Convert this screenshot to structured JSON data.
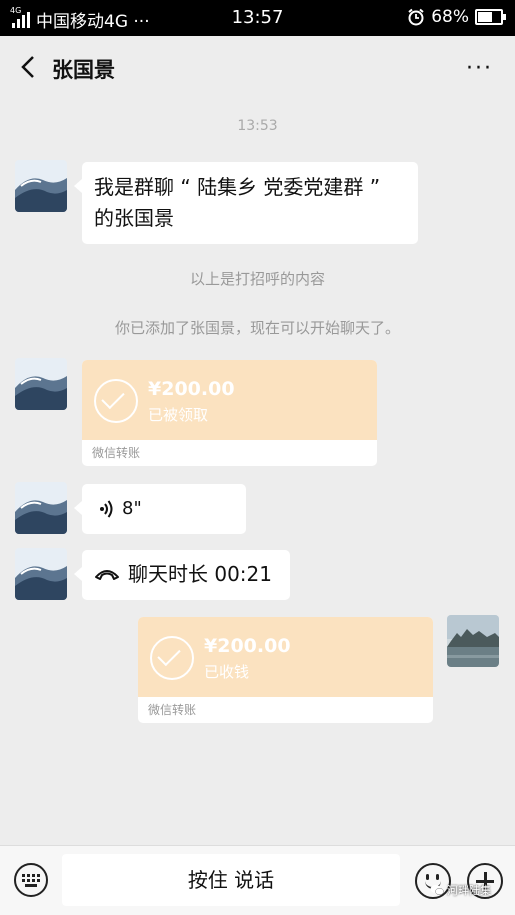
{
  "status_bar": {
    "network_badge": "4G",
    "carrier": "中国移动4G ···",
    "time": "13:57",
    "battery": "68%",
    "battery_level": 0.68
  },
  "nav": {
    "title": "张国景",
    "more": "···"
  },
  "chat": {
    "timestamp": "13:53",
    "greeting_line1": "我是群聊 “ 陆集乡 党委党建群 ”",
    "greeting_line2": "的张国景",
    "system_greet": "以上是打招呼的内容",
    "system_added": "你已添加了张国景，现在可以开始聊天了。",
    "transfer_in": {
      "amount": "¥200.00",
      "status": "已被领取",
      "label": "微信转账"
    },
    "voice": {
      "duration": "8\""
    },
    "call": {
      "text": "聊天时长 00:21"
    },
    "transfer_out": {
      "amount": "¥200.00",
      "status": "已收钱",
      "label": "微信转账"
    }
  },
  "bottom_bar": {
    "hold_to_talk": "按住 说话"
  },
  "watermark": "河畔陆集",
  "colors": {
    "transfer_bg": "#fbe2c0",
    "chat_bg": "#ededed"
  }
}
